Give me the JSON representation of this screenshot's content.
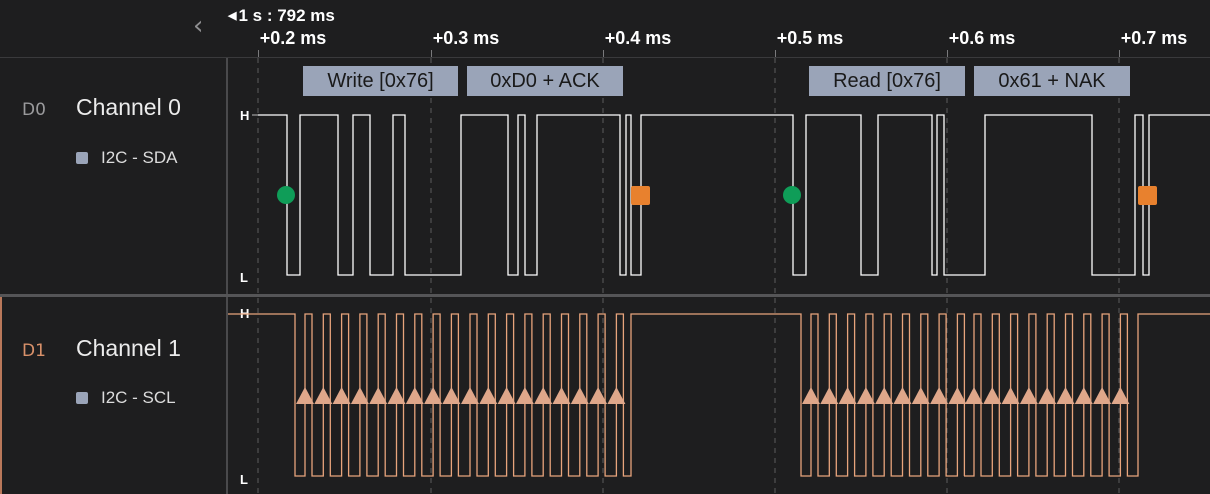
{
  "timeline": {
    "anchor": "1 s : 792 ms",
    "ticks": [
      "+0.2 ms",
      "+0.3 ms",
      "+0.4 ms",
      "+0.5 ms",
      "+0.6 ms",
      "+0.7 ms"
    ]
  },
  "channels": [
    {
      "id": "D0",
      "name": "Channel 0",
      "analyzer": "I2C - SDA",
      "high_label": "H",
      "low_label": "L",
      "color": "#ffffff"
    },
    {
      "id": "D1",
      "name": "Channel 1",
      "analyzer": "I2C - SCL",
      "high_label": "H",
      "low_label": "L",
      "color": "#e8a47c"
    }
  ],
  "protocol_frames": [
    {
      "label": "Write [0x76]"
    },
    {
      "label": "0xD0 + ACK"
    },
    {
      "label": "Read [0x76]"
    },
    {
      "label": "0x61 + NAK"
    }
  ],
  "markers": {
    "start_color": "#0f9d58",
    "stop_color": "#e8812e"
  },
  "colors": {
    "background": "#1e1e1f",
    "frame_box": "#9aa4b8",
    "scl": "#e8a47c",
    "sda": "#ffffff"
  }
}
